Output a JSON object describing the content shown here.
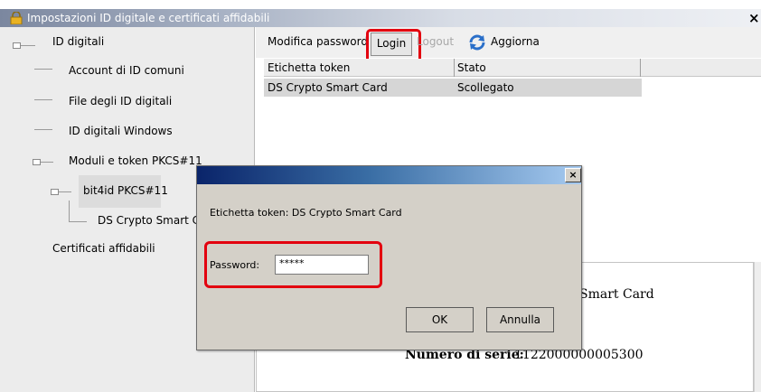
{
  "window": {
    "title": "Impostazioni ID digitale e certificati affidabili",
    "close_glyph": "×"
  },
  "tree": {
    "items": [
      {
        "label": "ID digitali"
      },
      {
        "label": "Account di ID comuni"
      },
      {
        "label": "File degli ID digitali"
      },
      {
        "label": "ID digitali Windows"
      },
      {
        "label": "Moduli e token PKCS#11"
      },
      {
        "label": "bit4id PKCS#11"
      },
      {
        "label": "DS Crypto Smart Ca"
      },
      {
        "label": "Certificati affidabili"
      }
    ]
  },
  "toolbar": {
    "change_password_label": "Modifica password",
    "login_label": "Login",
    "logout_label": "Logout",
    "refresh_label": "Aggiorna"
  },
  "table": {
    "columns": [
      "Etichetta token",
      "Stato"
    ],
    "rows": [
      {
        "label": "DS Crypto Smart Card",
        "status": "Scollegato"
      }
    ]
  },
  "detail": {
    "title_fragment": "Smart Card",
    "serial_label": "Numero di serie:",
    "serial_value": "1122000000005300"
  },
  "dialog": {
    "close_glyph": "×",
    "token_line": "Etichetta token: DS Crypto Smart Card",
    "password_label": "Password:",
    "password_value": "*****",
    "ok_label": "OK",
    "cancel_label": "Annulla"
  },
  "colors": {
    "highlight": "#e3000f",
    "dialog_title_start": "#0a246a",
    "dialog_title_end": "#a6caf0"
  }
}
